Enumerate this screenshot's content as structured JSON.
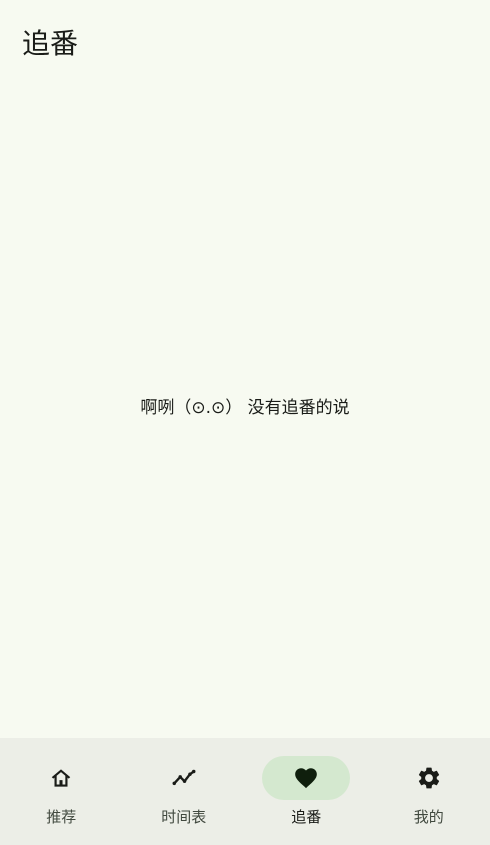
{
  "header": {
    "title": "追番"
  },
  "main": {
    "empty_message": "啊咧（⊙.⊙） 没有追番的说"
  },
  "bottom_nav": {
    "items": [
      {
        "label": "推荐",
        "icon": "home-icon",
        "active": false
      },
      {
        "label": "时间表",
        "icon": "timeline-icon",
        "active": false
      },
      {
        "label": "追番",
        "icon": "heart-icon",
        "active": true
      },
      {
        "label": "我的",
        "icon": "gear-icon",
        "active": false
      }
    ]
  },
  "colors": {
    "background": "#f7faf1",
    "nav_background": "#eceee7",
    "active_indicator": "#d4e8cf",
    "text": "#1a1c18"
  }
}
